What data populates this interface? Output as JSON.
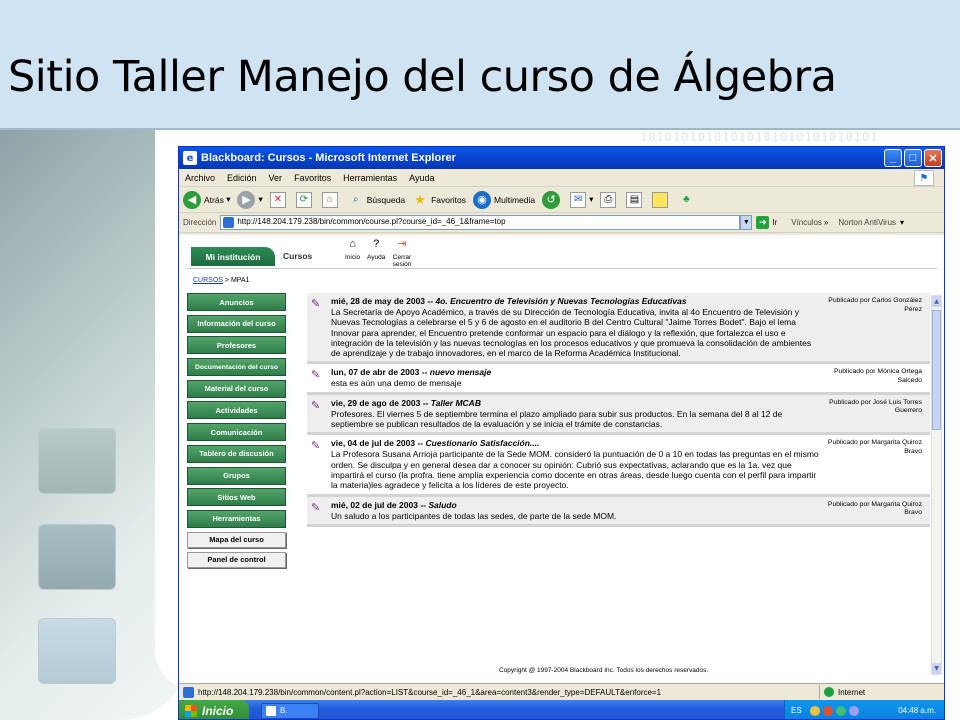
{
  "slide": {
    "title": "Sitio Taller Manejo del curso de Álgebra",
    "binary_bg": "10101010101010101010101010101",
    "colors": {
      "header": "#cfe3f2",
      "accent_green": "#2f7d4a",
      "xp_blue": "#245edb"
    }
  },
  "window": {
    "title": "Blackboard: Cursos - Microsoft Internet Explorer",
    "controls": {
      "minimize": "_",
      "maximize": "□",
      "close": "✕"
    }
  },
  "menu": [
    "Archivo",
    "Edición",
    "Ver",
    "Favoritos",
    "Herramientas",
    "Ayuda"
  ],
  "toolbar": {
    "back": "Atrás",
    "search": "Búsqueda",
    "favorites": "Favoritos",
    "multimedia": "Multimedia"
  },
  "address": {
    "label": "Dirección",
    "url": "http://148.204.179.238/bin/common/course.pl?course_id=_46_1&frame=top",
    "go": "Ir",
    "links": "Vínculos",
    "norton": "Norton AntiVirus"
  },
  "blackboard": {
    "tab_institution": "Mi institución",
    "tab_courses": "Cursos",
    "top_icons": [
      {
        "icon": "home-icon",
        "label": "Inicio"
      },
      {
        "icon": "help-icon",
        "label": "Ayuda"
      },
      {
        "icon": "logout-icon",
        "label": "Cerrar sesión"
      }
    ],
    "breadcrumb": {
      "root": "CURSOS",
      "sep": ">",
      "current": "MPA1"
    }
  },
  "nav": {
    "buttons": [
      "Anuncios",
      "Información del curso",
      "Profesores",
      "Documentación del curso",
      "Material del curso",
      "Actividades",
      "Comunicación",
      "Tablero de discusión",
      "Grupos",
      "Sitios Web",
      "Herramientas"
    ],
    "secondary": [
      "Mapa del curso",
      "Panel de control"
    ]
  },
  "announcements": [
    {
      "date": "mié, 28 de may de 2003",
      "sep": "--",
      "subject": "4o. Encuentro de Televisión y Nuevas Tecnologías Educativas",
      "body": "La Secretaría de Apoyo Académico, a través de su Dirección de Tecnología Educativa, invita al 4o Encuentro de Televisión y Nuevas Tecnologías a celebrarse el 5 y 6 de agosto en el auditorio B del Centro Cultural \"Jaime Torres Bodet\". Bajo el lema Innovar para aprender, el Encuentro pretende conformar un espacio para el diálogo y la reflexión, que fortalezca el uso e integración de la televisión y las nuevas tecnologías en los procesos educativos y que promueva la consolidación de ambientes de aprendizaje y de trabajo innovadores, en el marco de la Reforma Académica Institucional.",
      "posted_by": "Publicado por Carlos González Pérez"
    },
    {
      "date": "lun, 07 de abr de 2003",
      "sep": "--",
      "subject": "nuevo mensaje",
      "body": "esta es aún una demo de mensaje",
      "posted_by": "Publicado por Mónica Ortega Salcedo"
    },
    {
      "date": "vie, 29 de ago de 2003",
      "sep": "--",
      "subject": "Taller MCAB",
      "body": "Profesores. El viernes 5 de septiembre termina el plazo ampliado para subir sus productos. En la semana del 8 al 12 de septiembre se publican resultados de la evaluación y se inicia el trámite de constancias.",
      "posted_by": "Publicado por José Luis Torres Guerrero"
    },
    {
      "date": "vie, 04 de jul de 2003",
      "sep": "--",
      "subject": "Cuestionario Satisfacción....",
      "body": "La Profesora Susana Arrioja participante de la Sede MOM. consideró la puntuación de 0 a 10 en todas las preguntas en el mismo orden. Se disculpa y en general desea dar a conocer su opinión: Cubrió sus expectativas, aclarando que es la 1a. vez que impartirá el curso (la profra. tiene amplia experiencia como docente en otras áreas, desde luego cuenta con el perfil para impartir la materia)les agradece y felicita a los líderes de este proyecto.",
      "posted_by": "Publicado por Margarita Quiroz Bravo"
    },
    {
      "date": "mié, 02 de jul de 2003",
      "sep": "--",
      "subject": "Saludo",
      "body": "Un saludo a los participantes de todas las sedes, de parte de la sede MOM.",
      "posted_by": "Publicado por Margarita Quiroz Bravo"
    }
  ],
  "copyright": "Copyright @ 1997-2004 Blackboard Inc. Todos los derechos reservados.",
  "status": {
    "url": "http://148.204.179.238/bin/common/content.pl?action=LIST&course_id=_46_1&area=content3&render_type=DEFAULT&enforce=1",
    "zone": "Internet"
  },
  "taskbar": {
    "start": "Inicio",
    "item": "B.",
    "lang": "ES",
    "clock": "04:48 a.m."
  }
}
